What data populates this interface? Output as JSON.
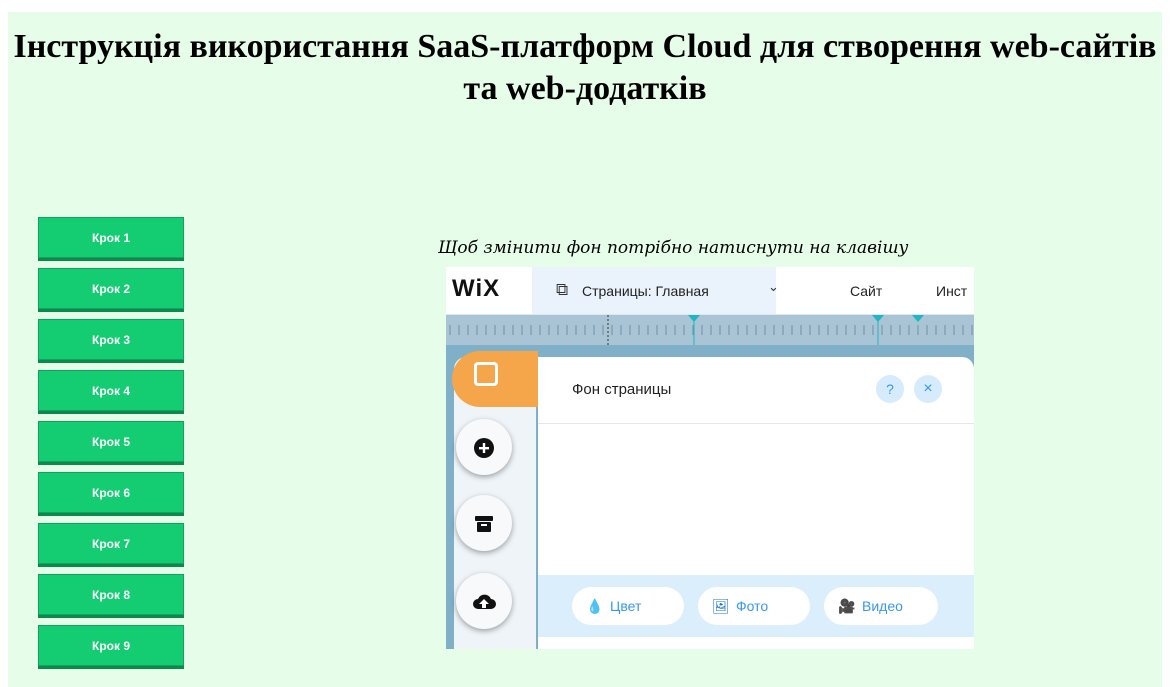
{
  "page": {
    "title": "Інструкція використання SaaS-платформ Cloud для створення web-сайтів та web-додатків"
  },
  "steps": [
    {
      "label": "Крок 1"
    },
    {
      "label": "Крок 2"
    },
    {
      "label": "Крок 3"
    },
    {
      "label": "Крок 4"
    },
    {
      "label": "Крок 5"
    },
    {
      "label": "Крок 6"
    },
    {
      "label": "Крок 7"
    },
    {
      "label": "Крок 8"
    },
    {
      "label": "Крок 9"
    }
  ],
  "caption": "Щоб змінити фон потрібно натиснути на клавішу",
  "screenshot": {
    "logo": "WiX",
    "page_selector": "Страницы: Главная",
    "chevron_icon": "chevron-down-icon",
    "menu_site": "Сайт",
    "menu_tools": "Инст",
    "panel_title": "Фон страницы",
    "help_label": "?",
    "close_label": "×",
    "buttons": [
      {
        "label": "Цвет",
        "icon": "drop-icon"
      },
      {
        "label": "Фото",
        "icon": "image-icon"
      },
      {
        "label": "Видео",
        "icon": "video-icon"
      }
    ]
  },
  "colors": {
    "page_bg": "#e6fde9",
    "step_button": "#14cc72",
    "accent_orange": "#f5a64a",
    "accent_blue": "#3899ec"
  }
}
